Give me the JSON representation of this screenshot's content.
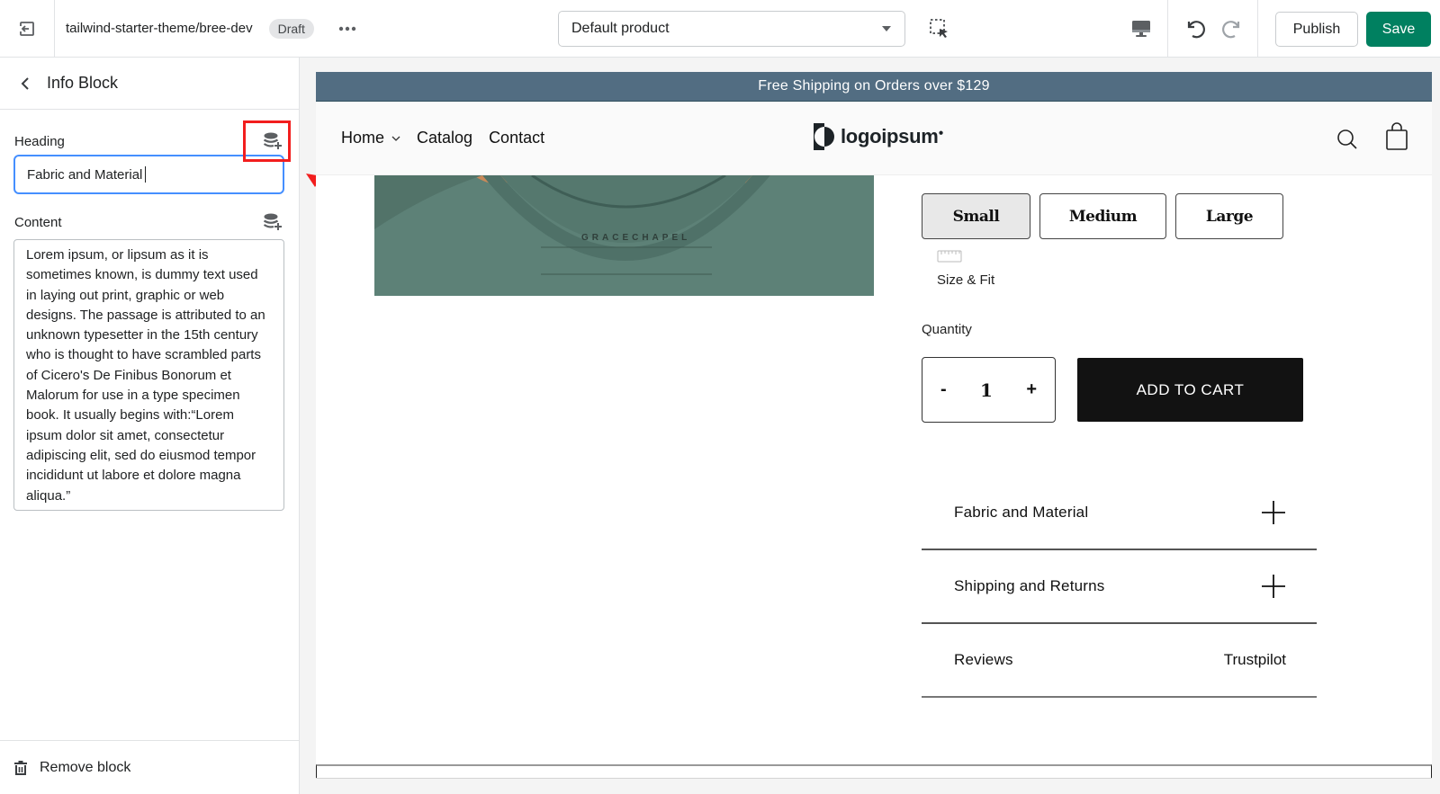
{
  "topbar": {
    "theme_name": "tailwind-starter-theme/bree-dev",
    "status_badge": "Draft",
    "template_select": {
      "selected": "Default product"
    },
    "publish_label": "Publish",
    "save_label": "Save",
    "save_color": "#008060"
  },
  "sidebar": {
    "title": "Info Block",
    "heading_field": {
      "label": "Heading",
      "value": "Fabric and Material"
    },
    "content_field": {
      "label": "Content",
      "value": "Lorem ipsum, or lipsum as it is sometimes known, is dummy text used in laying out print, graphic or web designs. The passage is attributed to an unknown typesetter in the 15th century who is thought to have scrambled parts of Cicero's De Finibus Bonorum et Malorum for use in a type specimen book. It usually begins with:“Lorem ipsum dolor sit amet, consectetur adipiscing elit, sed do eiusmod tempor incididunt ut labore et dolore magna aliqua.”"
    },
    "remove_label": "Remove block"
  },
  "preview": {
    "announcement": "Free Shipping on Orders over $129",
    "announcement_color": "#526d82",
    "nav": {
      "links": [
        "Home",
        "Catalog",
        "Contact"
      ],
      "logo_text": "logoipsum"
    },
    "product_image": {
      "tag_text": "GRACECHAPEL"
    },
    "sizes": [
      {
        "label": "Small",
        "selected": true
      },
      {
        "label": "Medium",
        "selected": false
      },
      {
        "label": "Large",
        "selected": false
      }
    ],
    "size_fit_label": "Size & Fit",
    "quantity_label": "Quantity",
    "quantity": {
      "minus": "-",
      "value": "1",
      "plus": "+"
    },
    "add_to_cart_label": "ADD TO CART",
    "accordion": [
      {
        "title": "Fabric and Material",
        "right": "+"
      },
      {
        "title": "Shipping and Returns",
        "right": "+"
      },
      {
        "title": "Reviews",
        "right": "Trustpilot"
      }
    ]
  },
  "annotation": {
    "highlight_color": "#f21e1e"
  }
}
